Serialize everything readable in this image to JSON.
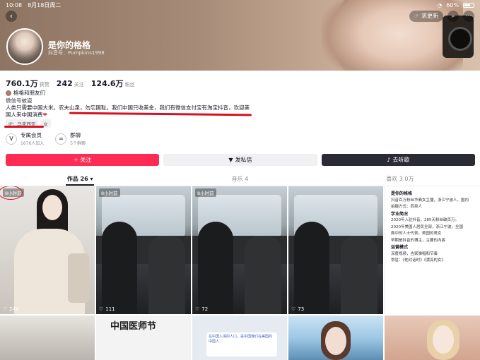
{
  "status_bar": {
    "time": "10:08",
    "date": "8月18日周二",
    "battery": "60%"
  },
  "header": {
    "nickname": "是你的格格",
    "douyin_id": "抖音号：Pumpkins1998",
    "update_label": "求更新"
  },
  "stats": [
    {
      "num": "760.1万",
      "label": "获赞"
    },
    {
      "num": "242",
      "label": "关注"
    },
    {
      "num": "124.6万",
      "label": "粉丝"
    }
  ],
  "bio": {
    "badge": "格格和朋友们",
    "line1": "微信号被盗",
    "line2": "人类只需要中国大米。农夫山泉，勿忘国耻。我们中国只收美金，我们有微信支付宝有淘宝抖音，欢迎美",
    "line3": "国人来中国消费",
    "heart": "❤"
  },
  "tags": [
    "IP：马来西亚",
    "女"
  ],
  "services": [
    {
      "icon": "V",
      "title": "专属会员",
      "sub": "1676人加入"
    },
    {
      "icon": "∞",
      "title": "群聊",
      "sub": "5个群聊"
    }
  ],
  "actions": {
    "follow": "+ 关注",
    "message": "发私信",
    "music": "去听歌"
  },
  "tabs": [
    {
      "label": "作品 26 ▾",
      "active": true
    },
    {
      "label": "音乐 4",
      "active": false
    },
    {
      "label": "喜欢 3.0万",
      "active": false
    }
  ],
  "grid": {
    "row1": [
      {
        "time": "8小时前",
        "likes": "246"
      },
      {
        "time": "8小时前",
        "likes": "111"
      },
      {
        "time": "8小时前",
        "likes": "72"
      },
      {
        "time": "",
        "likes": "73"
      },
      {
        "time": "",
        "likes": ""
      }
    ],
    "doc": {
      "title": "是你的格格",
      "lines": [
        "抖音百万粉丝华裔女主播，浙江宁波人，国内",
        "拍摄方式：四类人",
        "学业简况",
        "2020年入驻抖音，285天粉丝破百万。",
        "2020年美国人居民全部，浙江宁波，全国",
        "面中的人士代表，美国的男女",
        "早期是抖音的博主，主要的内容",
        "运营模式",
        "深度视频，吉家弹唱和节奏",
        "常驻：《他对话时》《漂亮的女》"
      ]
    },
    "row2_title": "中国医师节",
    "row2_chat": "在中国入境的人口，是中国我们在美国的中国人..."
  },
  "colors": {
    "accent": "#fe2c55",
    "dark_button": "#2a2b33",
    "annotation_red": "#d8101f"
  }
}
